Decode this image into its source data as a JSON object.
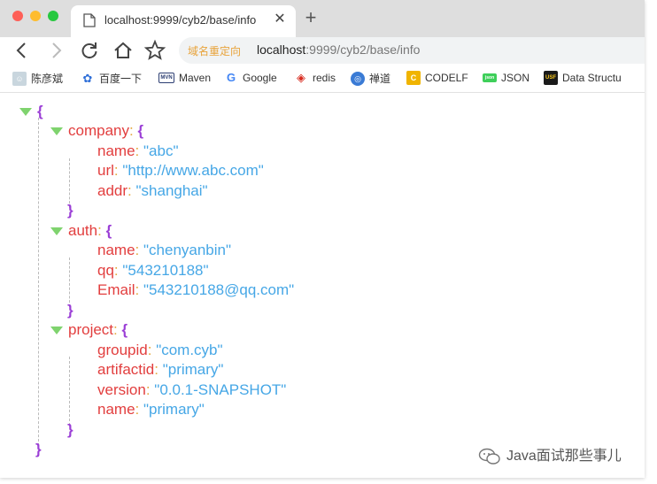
{
  "browser": {
    "tab_title": "localhost:9999/cyb2/base/info",
    "tab_close": "✕",
    "new_tab": "+",
    "omnibox_badge": "域名重定向",
    "url_host": "localhost",
    "url_rest": ":9999/cyb2/base/info"
  },
  "bookmarks": [
    {
      "label": "陈彦斌",
      "icon": "avatar-icon",
      "color": "#8aa"
    },
    {
      "label": "百度一下",
      "icon": "baidu-paw-icon",
      "color": "#2f6fd8"
    },
    {
      "label": "Maven",
      "icon": "maven-icon",
      "color": "#2c3e72",
      "icon_text": "MVN"
    },
    {
      "label": "Google",
      "icon": "google-icon",
      "color": "#4285f4",
      "icon_text": "G"
    },
    {
      "label": "redis",
      "icon": "redis-icon",
      "color": "#d82c20"
    },
    {
      "label": "禅道",
      "icon": "globe-icon",
      "color": "#3a7bd5"
    },
    {
      "label": "CODELF",
      "icon": "codelf-icon",
      "color": "#f0b400",
      "icon_text": "C"
    },
    {
      "label": "JSON",
      "icon": "json-icon",
      "color": "#3ecf5a",
      "icon_text": "json"
    },
    {
      "label": "Data Structu",
      "icon": "usf-icon",
      "color": "#1a1a1a",
      "icon_text": "USF"
    }
  ],
  "json_view": {
    "open_brace": "{",
    "close_brace": "}",
    "colon": ":",
    "company": {
      "key": "company",
      "name": {
        "key": "name",
        "value": "\"abc\""
      },
      "url": {
        "key": "url",
        "value": "\"http://www.abc.com\""
      },
      "addr": {
        "key": "addr",
        "value": "\"shanghai\""
      }
    },
    "auth": {
      "key": "auth",
      "name": {
        "key": "name",
        "value": "\"chenyanbin\""
      },
      "qq": {
        "key": "qq",
        "value": "\"543210188\""
      },
      "email": {
        "key": "Email",
        "value": "\"543210188@qq.com\""
      }
    },
    "project": {
      "key": "project",
      "groupid": {
        "key": "groupid",
        "value": "\"com.cyb\""
      },
      "artifactid": {
        "key": "artifactid",
        "value": "\"primary\""
      },
      "version": {
        "key": "version",
        "value": "\"0.0.1-SNAPSHOT\""
      },
      "name": {
        "key": "name",
        "value": "\"primary\""
      }
    }
  },
  "watermark": "Java面试那些事儿",
  "colors": {
    "key": "#e23e3e",
    "string": "#46a7e6",
    "brace": "#9b3fd6",
    "colon": "#e3a73c",
    "toggle": "#7fd36e"
  }
}
